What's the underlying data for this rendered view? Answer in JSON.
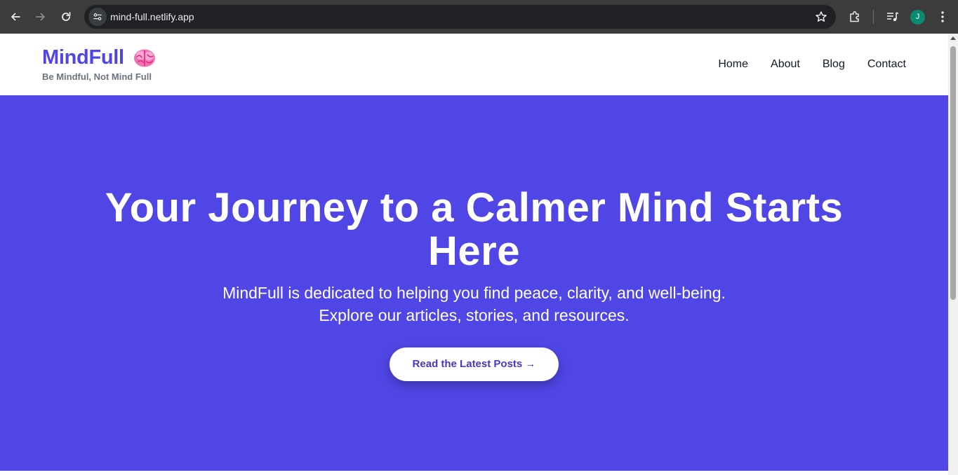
{
  "browser": {
    "url": "mind-full.netlify.app",
    "profile_initial": "J",
    "icons": [
      "back-arrow-icon",
      "forward-arrow-icon",
      "reload-icon",
      "site-settings-icon",
      "bookmark-star-icon",
      "extensions-puzzle-icon",
      "media-control-icon",
      "kebab-menu-icon"
    ]
  },
  "site": {
    "logo": "MindFull",
    "logo_icon": "brain-icon",
    "tagline": "Be Mindful, Not Mind Full",
    "nav": [
      {
        "label": "Home"
      },
      {
        "label": "About"
      },
      {
        "label": "Blog"
      },
      {
        "label": "Contact"
      }
    ]
  },
  "hero": {
    "title": "Your Journey to a Calmer Mind Starts Here",
    "subtitle_line1": "MindFull is dedicated to helping you find peace, clarity, and well-being.",
    "subtitle_line2": "Explore our articles, stories, and resources.",
    "cta": "Read the Latest Posts →"
  },
  "colors": {
    "brand": "#4f46e5",
    "chrome_bg": "#3c3c3c",
    "omnibox_bg": "#1f2124",
    "cta_text": "#4338ca",
    "tagline": "#6b7280"
  }
}
